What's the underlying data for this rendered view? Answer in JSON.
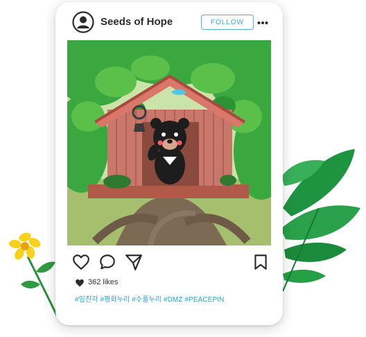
{
  "post": {
    "username": "Seeds of Hope",
    "follow_label": "FOLLOW",
    "likes": "362 likes",
    "hashtags": "#임진각 #평화누리 #수풀누리 #DMZ #PEACEPIN"
  },
  "icons": {
    "avatar": "user-circle-icon",
    "more": "more-horizontal-icon",
    "like": "heart-outline-icon",
    "comment": "speech-bubble-icon",
    "share": "paper-plane-icon",
    "save": "bookmark-icon",
    "likes_indicator": "heart-filled-icon"
  },
  "colors": {
    "accent": "#3aa5d8",
    "leaf": "#2aa14a",
    "flower": "#f6d21c"
  }
}
